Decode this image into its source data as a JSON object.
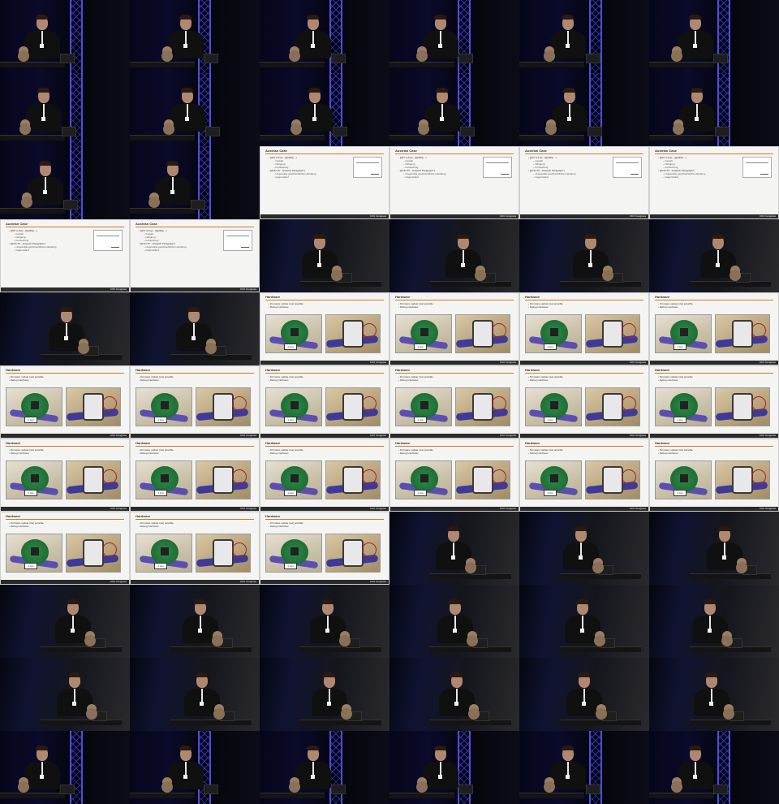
{
  "contact_sheet": {
    "rows": 11,
    "cols": 6,
    "frames": [
      "speaker-blue",
      "speaker-blue",
      "speaker-blue",
      "speaker-blue",
      "speaker-blue",
      "speaker-blue",
      "speaker-blue",
      "speaker-blue",
      "speaker-blue",
      "speaker-blue",
      "speaker-blue",
      "speaker-blue",
      "speaker-blue",
      "speaker-blue",
      "slide-austrian",
      "slide-austrian",
      "slide-austrian",
      "slide-austrian",
      "slide-austrian",
      "slide-austrian",
      "speaker-grey",
      "speaker-grey",
      "speaker-grey",
      "speaker-grey",
      "speaker-grey",
      "speaker-grey",
      "slide-hardware",
      "slide-hardware",
      "slide-hardware",
      "slide-hardware",
      "slide-hardware",
      "slide-hardware",
      "slide-hardware",
      "slide-hardware",
      "slide-hardware",
      "slide-hardware",
      "slide-hardware",
      "slide-hardware",
      "slide-hardware",
      "slide-hardware",
      "slide-hardware",
      "slide-hardware",
      "slide-hardware",
      "slide-hardware",
      "slide-hardware",
      "speaker-grey",
      "speaker-grey",
      "speaker-grey",
      "speaker-grey",
      "speaker-grey",
      "speaker-grey",
      "speaker-grey",
      "speaker-grey",
      "speaker-grey",
      "speaker-grey",
      "speaker-grey",
      "speaker-grey",
      "speaker-grey",
      "speaker-grey",
      "speaker-grey",
      "speaker-blue",
      "speaker-blue",
      "speaker-blue",
      "speaker-blue",
      "speaker-blue",
      "speaker-blue"
    ]
  },
  "slides": {
    "austrian": {
      "title": "Austrian Case",
      "bullets": [
        {
          "text": "§207 (Urspr...)§(Hilfsp...)",
          "sub": false
        },
        {
          "text": "Gewalt",
          "sub": true
        },
        {
          "text": "Nötigung",
          "sub": true
        },
        {
          "text": "Fortsetzung",
          "sub": true
        },
        {
          "text": "§218 (\"Pr...Grapsch Paragraph\")",
          "sub": false
        },
        {
          "text": "Ungewollte geschlechtliche Handlung",
          "sub": true
        },
        {
          "text": "Gegenstand",
          "sub": true
        }
      ]
    },
    "hardware": {
      "title": "Hardware",
      "bullets": [
        {
          "text": "Firmware update (via) possible",
          "sub": false
        },
        {
          "text": "Debug interfaces",
          "sub": false
        }
      ],
      "scale_label": "1 mm"
    },
    "footer_brand": "CCC Congress"
  },
  "colors": {
    "slide_rule": "#d07a2a",
    "truss": "#3a3ad0",
    "pcb": "#2e8a48",
    "strap": "#5a4fb0"
  }
}
